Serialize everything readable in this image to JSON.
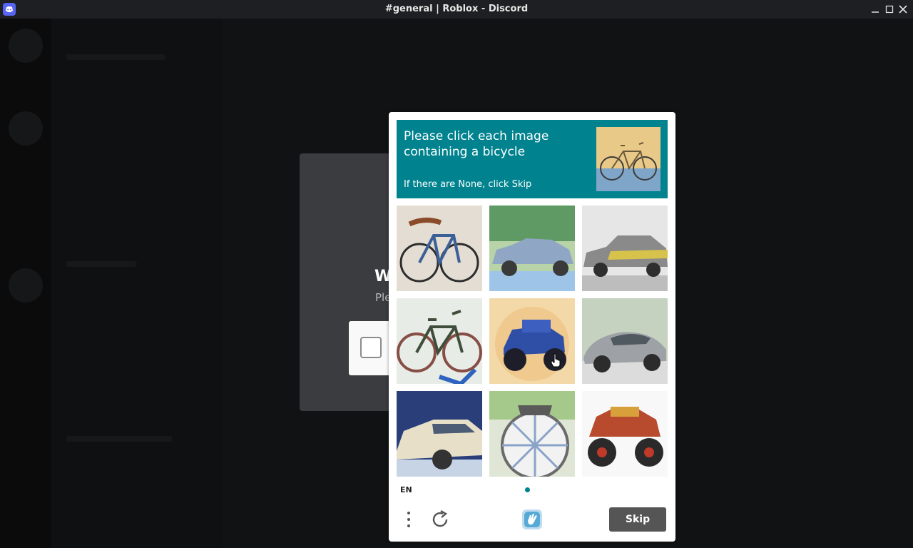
{
  "window": {
    "title": "#general | Roblox - Discord",
    "controls": [
      "minimize-icon",
      "maximize-icon",
      "close-icon"
    ]
  },
  "verify_modal": {
    "title_partial": "W",
    "subtitle_partial": "Ple"
  },
  "captcha": {
    "prompt": "Please click each image containing a bicycle",
    "hint": "If there are None, click Skip",
    "example_image": "bicycle",
    "tiles": [
      "bicycle",
      "car",
      "car",
      "bicycle",
      "monster-truck",
      "car",
      "car",
      "bicycle",
      "monster-truck"
    ],
    "language": "EN",
    "skip_label": "Skip",
    "colors": {
      "accent": "#00838f",
      "skip_button": "#555555"
    }
  }
}
